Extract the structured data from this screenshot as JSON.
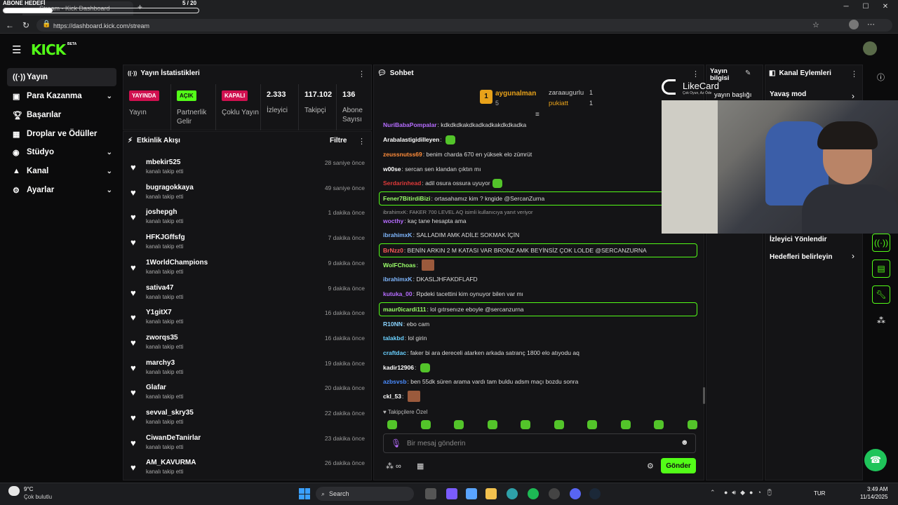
{
  "browser": {
    "overlay_title": "ABONE HEDEFİ",
    "overlay_count": "5 / 20",
    "tab_title": "Stream - Kick Dashboard",
    "url": "https://dashboard.kick.com/stream"
  },
  "logo": {
    "text": "KICK",
    "beta": "BETA"
  },
  "nav": [
    {
      "label": "Yayın",
      "icon": "broadcast-icon"
    },
    {
      "label": "Para Kazanma",
      "icon": "money-icon"
    },
    {
      "label": "Başarılar",
      "icon": "trophy-icon"
    },
    {
      "label": "Droplar ve Ödüller",
      "icon": "gift-icon"
    },
    {
      "label": "Stüdyo",
      "icon": "studio-icon"
    },
    {
      "label": "Kanal",
      "icon": "person-icon"
    },
    {
      "label": "Ayarlar",
      "icon": "gear-icon"
    }
  ],
  "stats": {
    "title": "Yayın İstatistikleri",
    "items": [
      {
        "badge": "YAYINDA",
        "label": "Yayın"
      },
      {
        "badge": "AÇIK",
        "label": "Partnerlik Gelir"
      },
      {
        "badge": "KAPALI",
        "label": "Çoklu Yayın"
      },
      {
        "value": "2.333",
        "label": "İzleyici"
      },
      {
        "value": "117.102",
        "label": "Takipçi"
      },
      {
        "value": "136",
        "label": "Abone Sayısı"
      }
    ]
  },
  "activity": {
    "title": "Etkinlik Akışı",
    "filter": "Filtre",
    "action": "kanalı takip etti",
    "items": [
      {
        "user": "mbekir525",
        "time": "28 saniye önce"
      },
      {
        "user": "bugragokkaya",
        "time": "49 saniye önce"
      },
      {
        "user": "joshepgh",
        "time": "1 dakika önce"
      },
      {
        "user": "HFKJGffsfg",
        "time": "7 dakika önce"
      },
      {
        "user": "1WorldChampions",
        "time": "9 dakika önce"
      },
      {
        "user": "sativa47",
        "time": "9 dakika önce"
      },
      {
        "user": "Y1gitX7",
        "time": "16 dakika önce"
      },
      {
        "user": "zworqs35",
        "time": "16 dakika önce"
      },
      {
        "user": "marchy3",
        "time": "19 dakika önce"
      },
      {
        "user": "Glafar",
        "time": "20 dakika önce"
      },
      {
        "user": "sevval_skry35",
        "time": "22 dakika önce"
      },
      {
        "user": "CiwanDeTanirlar",
        "time": "23 dakika önce"
      },
      {
        "user": "AM_KAVURMA",
        "time": "26 dakika önce"
      }
    ]
  },
  "chat": {
    "title": "Sohbet",
    "top1": {
      "name": "aygunalman",
      "count": "5",
      "rank": "1"
    },
    "top2": {
      "name": "zaraaugurlu",
      "count": "1"
    },
    "top3": {
      "name": "pukiatt",
      "count": "1"
    },
    "messages": [
      {
        "user": "NuriBabaPompalar",
        "color": "#b66cff",
        "text": "kdkdkdkakdkadkadkakdkdkadka"
      },
      {
        "user": "Arabalastigidilleyen",
        "color": "#ffffff",
        "text": ""
      },
      {
        "user": "zeussnutss69",
        "color": "#ff8c3a",
        "text": "benim charda 670 en yüksek elo zümrüt"
      },
      {
        "user": "w00se",
        "color": "#ffffff",
        "text": "sercan sen klandan çıktın mı"
      },
      {
        "user": "Serdarinhead",
        "color": "#e03a3a",
        "text": "adil osura ossura uyuyor"
      },
      {
        "user": "Fener7BitirdiBizi",
        "color": "#9bff6a",
        "text": "ortasahamız kim ? kngide @SercanZurna"
      },
      {
        "user": "wocthy",
        "color": "#b66cff",
        "text": "kaç tane hesapta ama"
      },
      {
        "user": "ibrahimxK",
        "color": "#7fb7ff",
        "text": "SALLADIM AMK ADİLE SOKMAK İÇİN"
      },
      {
        "user": "BrNzz0",
        "color": "#ff5a5a",
        "text": "BENİN ARKIN 2 M KATASI VAR BRONZ AMK BEYİNSİZ ÇOK LOLDE @SERCANZURNA"
      },
      {
        "user": "WolFChoas",
        "color": "#9bff6a",
        "text": ""
      },
      {
        "user": "ibrahimxK",
        "color": "#7fb7ff",
        "text": "DKASLJHFAKDFLAFD"
      },
      {
        "user": "kutuka_00",
        "color": "#b66cff",
        "text": "Rpdeki tacettini kim oynuyor bilen var mı"
      },
      {
        "user": "maur0icardi111",
        "color": "#9bff6a",
        "text": "lol gıtrsenıze eboyle @sercanzurna"
      },
      {
        "user": "R10NN",
        "color": "#8ad4ff",
        "text": "ebo cam"
      },
      {
        "user": "talakbd",
        "color": "#6ad0ff",
        "text": "lol girin"
      },
      {
        "user": "craftdac",
        "color": "#6ad0ff",
        "text": "faker bi ara dereceli atarken arkada satranç 1800 elo atıyodu aq"
      },
      {
        "user": "kadir12906",
        "color": "#ffffff",
        "text": ""
      },
      {
        "user": "azbsvsb",
        "color": "#4a8cff",
        "text": "ben 55dk süren arama vardı tam buldu adsm maçı bozdu sonra"
      },
      {
        "user": "ckl_53",
        "color": "#ffffff",
        "text": ""
      }
    ],
    "reply_note": "ibrahimxK: FAKER 700 LEVEL AQ isimli kullanıcıya yanıt veriyor",
    "emote_label": "Takipçilere Özel",
    "input_placeholder": "Bir mesaj gönderin",
    "send": "Gönder"
  },
  "streaminfo": {
    "title": "Yayın bilgisi",
    "field": "yayın başlığı"
  },
  "channel_actions": {
    "title": "Kanal Eylemleri",
    "items": [
      "Yavaş mod",
      "İzleyici Yönlendir",
      "Hedefleri belirleyin"
    ]
  },
  "overlay": {
    "brand": "LikeCard",
    "tag": "Çok Oyun, Az Öde"
  },
  "taskbar": {
    "weather_temp": "9°C",
    "weather_desc": "Çok bulutlu",
    "search": "Search",
    "lang": "TUR",
    "time": "3:49 AM",
    "date": "11/14/2025"
  },
  "colors": {
    "accent": "#53fc18",
    "live": "#d0104f"
  }
}
